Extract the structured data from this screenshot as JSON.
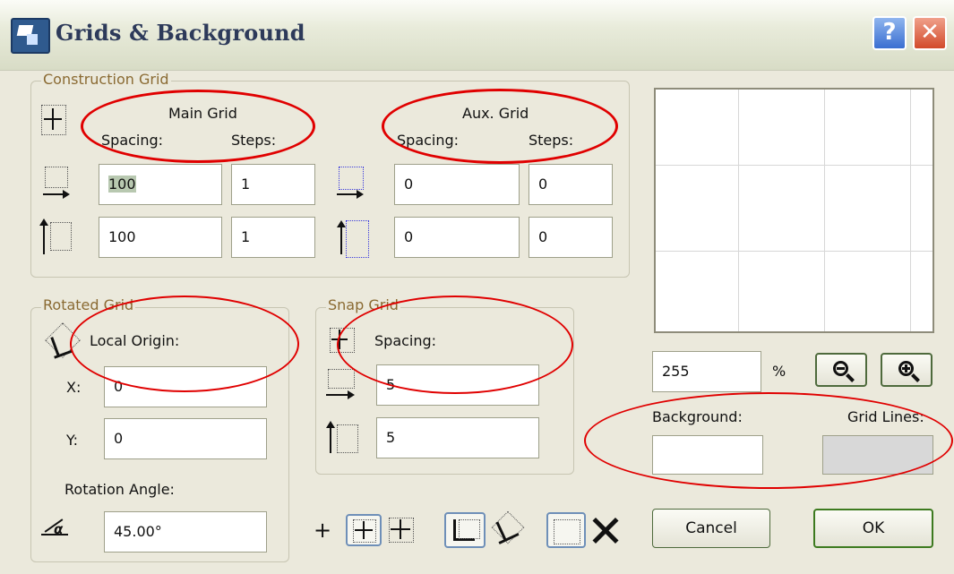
{
  "window": {
    "title": "Grids & Background",
    "help_label": "?",
    "close_label": "✕"
  },
  "construction_grid": {
    "label": "Construction Grid",
    "main_grid": {
      "title": "Main Grid",
      "spacing_label": "Spacing:",
      "steps_label": "Steps:",
      "x_spacing": "100",
      "x_steps": "1",
      "y_spacing": "100",
      "y_steps": "1"
    },
    "aux_grid": {
      "title": "Aux. Grid",
      "spacing_label": "Spacing:",
      "steps_label": "Steps:",
      "x_spacing": "0",
      "x_steps": "0",
      "y_spacing": "0",
      "y_steps": "0"
    }
  },
  "rotated_grid": {
    "label": "Rotated Grid",
    "local_origin_label": "Local Origin:",
    "x_label": "X:",
    "x_value": "0",
    "y_label": "Y:",
    "y_value": "0",
    "rotation_label": "Rotation Angle:",
    "rotation_value": "45.00°"
  },
  "snap_grid": {
    "label": "Snap Grid",
    "spacing_label": "Spacing:",
    "x_value": "5",
    "y_value": "5"
  },
  "preview": {
    "zoom_value": "255",
    "zoom_unit": "%",
    "background_label": "Background:",
    "grid_lines_label": "Grid Lines:",
    "background_color": "#ffffff",
    "grid_lines_color": "#d8d8d8"
  },
  "toolbar": {
    "plus_label": "+"
  },
  "actions": {
    "cancel_label": "Cancel",
    "ok_label": "OK"
  },
  "colors": {
    "annotation": "#e00000",
    "group_label": "#8a6a32",
    "dialog_bg": "#ebe9dc"
  }
}
